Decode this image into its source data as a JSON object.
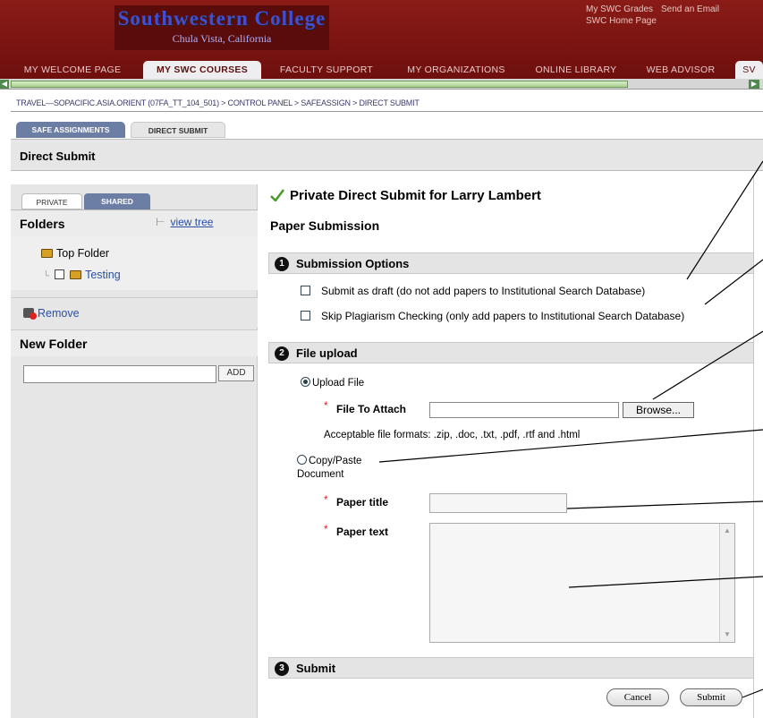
{
  "header": {
    "logo_title": "Southwestern College",
    "logo_subtitle": "Chula Vista, California",
    "top_links": [
      "My SWC Grades",
      "Send an Email",
      "SWC Home Page"
    ]
  },
  "nav_tabs": [
    {
      "label": "MY WELCOME PAGE",
      "active": false
    },
    {
      "label": "MY SWC COURSES",
      "active": true
    },
    {
      "label": "FACULTY SUPPORT",
      "active": false
    },
    {
      "label": "MY ORGANIZATIONS",
      "active": false
    },
    {
      "label": "ONLINE LIBRARY",
      "active": false
    },
    {
      "label": "WEB ADVISOR",
      "active": false
    },
    {
      "label": "SV",
      "active": false
    }
  ],
  "breadcrumb": "TRAVEL—SOPACIFIC.ASIA.ORIENT (07FA_TT_104_501) > CONTROL PANEL > SAFEASSIGN > DIRECT SUBMIT",
  "subtabs": {
    "safe": "SAFE ASSIGNMENTS",
    "direct": "DIRECT SUBMIT"
  },
  "section_title": "Direct Submit",
  "left_panel": {
    "tab_private": "PRIVATE",
    "tab_shared": "SHARED",
    "folders_title": "Folders",
    "view_tree": "view tree",
    "top_folder": "Top Folder",
    "sub_folder": "Testing",
    "remove": "Remove",
    "new_folder_title": "New Folder",
    "new_folder_value": "",
    "add_label": "ADD"
  },
  "main": {
    "title": "Private Direct Submit for Larry Lambert",
    "subtitle": "Paper Submission",
    "section1": {
      "num": "1",
      "label": "Submission Options"
    },
    "option_draft": "Submit as draft (do not add papers to Institutional Search Database)",
    "option_skip": "Skip Plagiarism Checking (only add papers to Institutional Search Database)",
    "section2": {
      "num": "2",
      "label": "File upload"
    },
    "radio_upload": "Upload File",
    "file_label": "File To Attach",
    "browse": "Browse...",
    "formats": "Acceptable file formats: .zip, .doc, .txt, .pdf, .rtf and .html",
    "radio_paste": "Copy/Paste Document",
    "paper_title_label": "Paper title",
    "paper_title_value": "",
    "paper_text_label": "Paper text",
    "paper_text_value": "",
    "section3": {
      "num": "3",
      "label": "Submit"
    },
    "cancel": "Cancel",
    "submit": "Submit"
  },
  "colors": {
    "header": "#7a1412",
    "accent_tab": "#6d7ea4",
    "link": "#2a4fa4",
    "required": "#dd2222"
  }
}
